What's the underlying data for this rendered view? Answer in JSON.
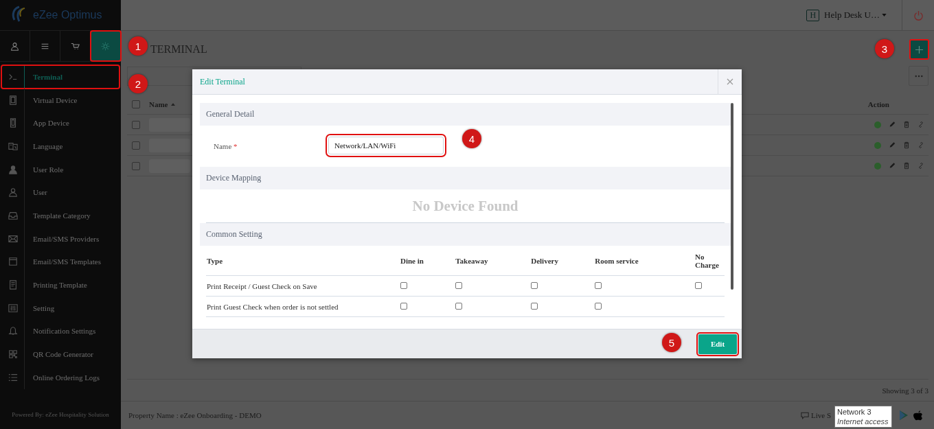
{
  "app": {
    "logo_text": "eZee Optimus"
  },
  "header": {
    "user_initial": "H",
    "user_name": "Help Desk U…"
  },
  "sidebar": {
    "tabs": [
      {
        "kind": "user",
        "selected": false,
        "marked": false
      },
      {
        "kind": "menu",
        "selected": false,
        "marked": false
      },
      {
        "kind": "cart",
        "selected": false,
        "marked": false
      },
      {
        "kind": "gear",
        "selected": true,
        "marked": true
      }
    ],
    "items": [
      {
        "kind": "terminal",
        "label": "Terminal",
        "selected": true,
        "marked": true
      },
      {
        "kind": "tablet",
        "label": "Virtual Device",
        "selected": false,
        "marked": false
      },
      {
        "kind": "phone",
        "label": "App Device",
        "selected": false,
        "marked": false
      },
      {
        "kind": "language",
        "label": "Language",
        "selected": false,
        "marked": false
      },
      {
        "kind": "role",
        "label": "User Role",
        "selected": false,
        "marked": false
      },
      {
        "kind": "user",
        "label": "User",
        "selected": false,
        "marked": false
      },
      {
        "kind": "inbox",
        "label": "Template Category",
        "selected": false,
        "marked": false
      },
      {
        "kind": "mail",
        "label": "Email/SMS Providers",
        "selected": false,
        "marked": false
      },
      {
        "kind": "window",
        "label": "Email/SMS Templates",
        "selected": false,
        "marked": false
      },
      {
        "kind": "document",
        "label": "Printing Template",
        "selected": false,
        "marked": false
      },
      {
        "kind": "sliders",
        "label": "Setting",
        "selected": false,
        "marked": false
      },
      {
        "kind": "bell",
        "label": "Notification Settings",
        "selected": false,
        "marked": false
      },
      {
        "kind": "qr",
        "label": "QR Code Generator",
        "selected": false,
        "marked": false
      },
      {
        "kind": "list",
        "label": "Online Ordering Logs",
        "selected": false,
        "marked": false
      }
    ],
    "footer": "Powered By: eZee Hospitality Solution"
  },
  "page": {
    "title": "TERMINAL",
    "add_marked": true,
    "all_checked": false,
    "columns": [
      "Name",
      "Action"
    ],
    "rows": [
      {
        "checked": false,
        "color": "#2b5e2b"
      },
      {
        "checked": false,
        "color": "#2b5e2b"
      },
      {
        "checked": false,
        "color": "#2b5e2b"
      }
    ],
    "count": "Showing 3 of 3"
  },
  "footer": {
    "property": "Property Name : eZee Onboarding - DEMO",
    "live": "Live S"
  },
  "modal": {
    "title": "Edit Terminal",
    "general_title": "General Detail",
    "name_label": "Name",
    "required": "*",
    "name_value": "Network/LAN/WiFi",
    "name_marked": true,
    "device_title": "Device Mapping",
    "empty": "No Device Found",
    "settings_title": "Common Setting",
    "columns": [
      "Type",
      "Dine in",
      "Takeaway",
      "Delivery",
      "Room service",
      "No Charge"
    ],
    "rows": [
      {
        "label": "Print Receipt / Guest Check on Save",
        "checks": [
          false,
          false,
          false,
          false,
          false
        ]
      },
      {
        "label": "Print Guest Check when order is not settled",
        "checks": [
          false,
          false,
          false,
          false
        ]
      }
    ],
    "button": {
      "label": "Edit",
      "marked": true
    }
  },
  "annotations": [
    "1",
    "2",
    "3",
    "4",
    "5"
  ],
  "tooltip": {
    "title": "Network 3",
    "subtitle": "Internet access"
  }
}
